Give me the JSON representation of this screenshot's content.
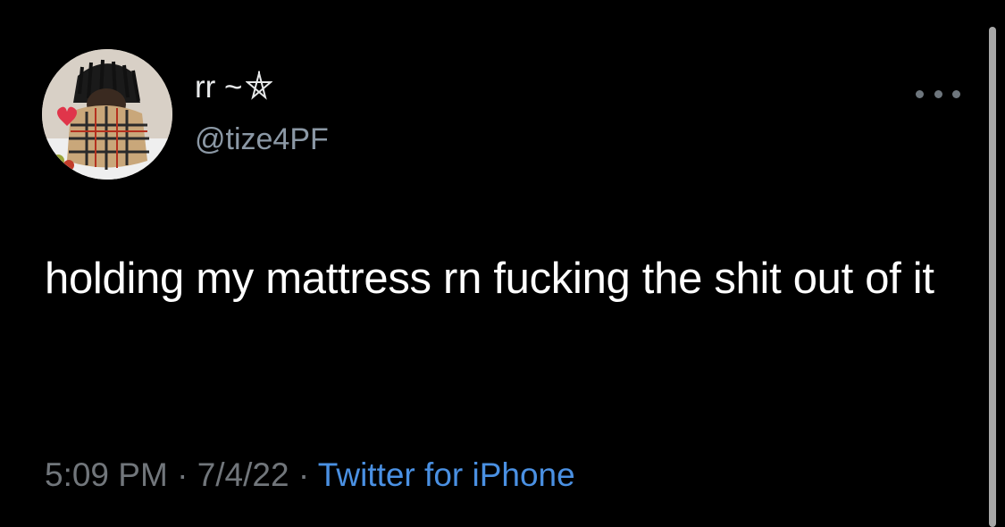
{
  "tweet": {
    "author": {
      "display_name": "rr ~",
      "display_name_symbol": "pentagram-star-icon",
      "handle": "@tize4PF",
      "avatar": "avatar-photo"
    },
    "text": "holding my mattress rn fucking the shit out of it",
    "time": "5:09 PM",
    "separator": "·",
    "date": "7/4/22",
    "source": "Twitter for iPhone",
    "more_menu_icon": "more-icon"
  },
  "colors": {
    "background": "#000000",
    "text": "#ffffff",
    "secondary_text": "#71767b",
    "link": "#4a90e2"
  }
}
